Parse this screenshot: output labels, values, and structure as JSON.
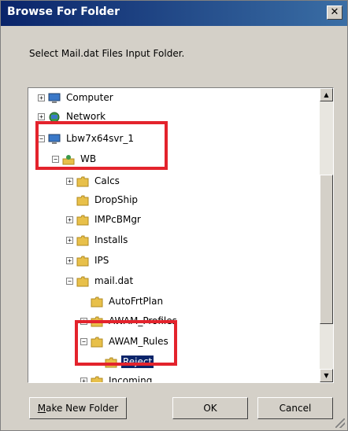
{
  "window": {
    "title": "Browse For Folder",
    "close_glyph": "✕"
  },
  "instruction": "Select Mail.dat Files Input Folder.",
  "tree": {
    "items": [
      {
        "label": "Computer",
        "icon": "computer-icon",
        "expander": "+"
      },
      {
        "label": "Network",
        "icon": "network-icon",
        "expander": "+"
      },
      {
        "label": "Lbw7x64svr_1",
        "icon": "computer-icon",
        "expander": "−"
      },
      {
        "label": "WB",
        "icon": "user-folder-icon",
        "expander": "−"
      },
      {
        "label": "Calcs",
        "icon": "folder-icon",
        "expander": "+"
      },
      {
        "label": "DropShip",
        "icon": "folder-icon",
        "expander": ""
      },
      {
        "label": "IMPcBMgr",
        "icon": "folder-icon",
        "expander": "+"
      },
      {
        "label": "Installs",
        "icon": "folder-icon",
        "expander": "+"
      },
      {
        "label": "IPS",
        "icon": "folder-icon",
        "expander": "+"
      },
      {
        "label": "mail.dat",
        "icon": "folder-icon",
        "expander": "−"
      },
      {
        "label": "AutoFrtPlan",
        "icon": "folder-icon",
        "expander": ""
      },
      {
        "label": "AWAM_Profiles",
        "icon": "folder-icon",
        "expander": "+"
      },
      {
        "label": "AWAM_Rules",
        "icon": "folder-icon",
        "expander": "−"
      },
      {
        "label": "Reject",
        "icon": "folder-icon",
        "expander": "",
        "selected": true
      },
      {
        "label": "Incoming",
        "icon": "folder-icon",
        "expander": "+"
      }
    ]
  },
  "scrollbar": {
    "up": "▲",
    "down": "▼"
  },
  "buttons": {
    "make_new_folder_mnemonic": "M",
    "make_new_folder_rest": "ake New Folder",
    "ok": "OK",
    "cancel": "Cancel"
  },
  "colors": {
    "highlight": "#e3232c",
    "selection": "#0a246a",
    "folder": "#e8c04a"
  }
}
